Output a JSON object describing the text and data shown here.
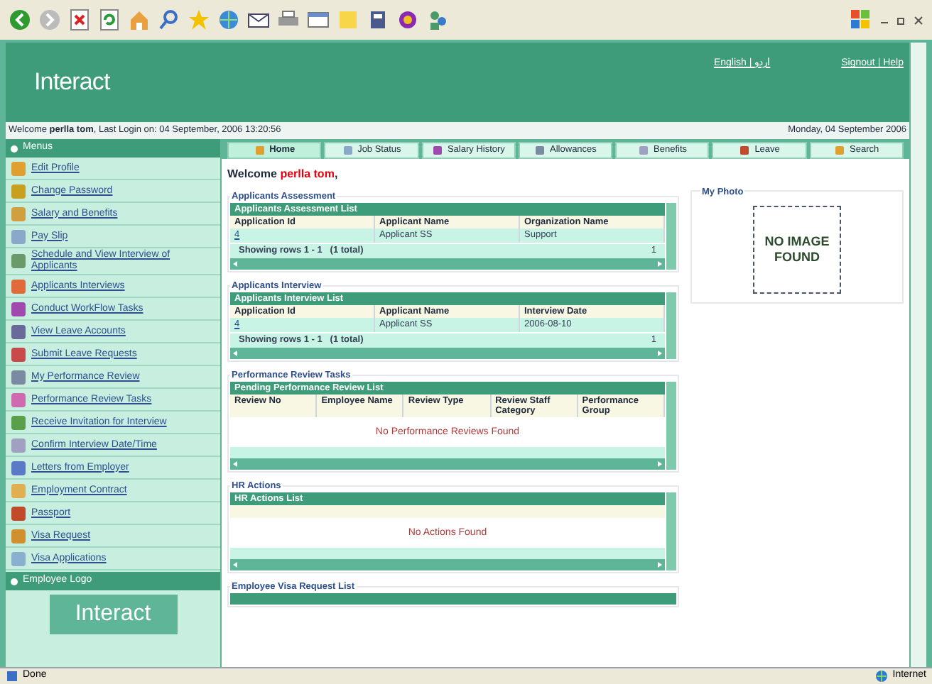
{
  "header": {
    "logo": "Interact",
    "links": [
      "English | اردو",
      "Signout | Help"
    ]
  },
  "welcome_bar": {
    "text": "Welcome **perlla tom**, Last Login on: 04 September, 2006 13:20:56",
    "date": "Monday, 04 September 2006"
  },
  "sidebar": {
    "header": "Menus",
    "items": [
      {
        "label": "Edit Profile"
      },
      {
        "label": "Change Password"
      },
      {
        "label": "Salary and Benefits"
      },
      {
        "label": "Pay Slip"
      },
      {
        "label": "Schedule and View Interview of Applicants"
      },
      {
        "label": "Applicants Interviews"
      },
      {
        "label": "Conduct WorkFlow Tasks"
      },
      {
        "label": "View Leave Accounts"
      },
      {
        "label": "Submit Leave Requests"
      },
      {
        "label": "My Performance Review"
      },
      {
        "label": "Performance Review Tasks"
      },
      {
        "label": "Receive Invitation for Interview"
      },
      {
        "label": "Confirm Interview Date/Time"
      },
      {
        "label": "Letters from Employer"
      },
      {
        "label": "Employment Contract"
      },
      {
        "label": "Passport"
      },
      {
        "label": "Visa Request"
      },
      {
        "label": "Visa Applications"
      }
    ],
    "logo_header": "Employee Logo",
    "logo": "Interact"
  },
  "tabs": [
    {
      "label": "Home",
      "selected": true
    },
    {
      "label": "Job Status",
      "selected": false
    },
    {
      "label": "Salary History",
      "selected": false
    },
    {
      "label": "Allowances",
      "selected": false
    },
    {
      "label": "Benefits",
      "selected": false
    },
    {
      "label": "Leave",
      "selected": false
    },
    {
      "label": "Search",
      "selected": false
    }
  ],
  "greeting": "Welcome **perlla tom**,",
  "sections": [
    {
      "title": "Applicants Assessment",
      "list_title": "Applicants Assessment List",
      "columns": [
        "Application Id",
        "Applicant Name",
        "Organization Name"
      ],
      "rows": [
        [
          "4",
          "Applicant SS",
          "Support"
        ]
      ],
      "footer": "Showing rows 1 - 1   (1 total)",
      "page": "1"
    },
    {
      "title": "Applicants Interview",
      "list_title": "Applicants Interview List",
      "columns": [
        "Application Id",
        "Applicant Name",
        "Interview Date"
      ],
      "rows": [
        [
          "4",
          "Applicant SS",
          "2006-08-10"
        ]
      ],
      "footer": "Showing rows 1 - 1   (1 total)",
      "page": "1"
    },
    {
      "title": "Performance Review Tasks",
      "list_title": "Pending Performance Review List",
      "columns": [
        "Review No",
        "Employee Name",
        "Review Type",
        "Review Staff Category",
        "Performance Group"
      ],
      "empty": "No Performance Reviews Found"
    },
    {
      "title": "HR Actions",
      "list_title": "HR Actions List",
      "empty": "No Actions Found"
    },
    {
      "title": "Employee Visa Request List"
    }
  ],
  "photo": {
    "title": "My Photo",
    "placeholder": "NO IMAGE FOUND"
  },
  "status_bar": {
    "text": "Done",
    "zone": "Internet"
  }
}
